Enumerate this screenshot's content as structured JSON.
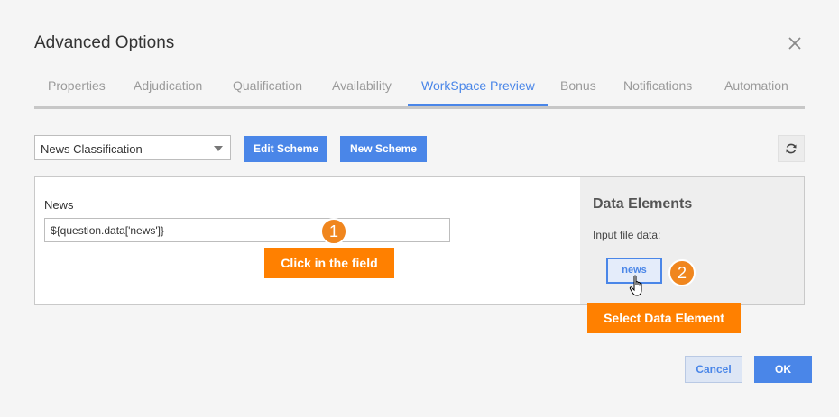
{
  "dialog": {
    "title": "Advanced Options"
  },
  "tabs": [
    {
      "label": "Properties"
    },
    {
      "label": "Adjudication"
    },
    {
      "label": "Qualification"
    },
    {
      "label": "Availability"
    },
    {
      "label": "WorkSpace Preview",
      "active": true
    },
    {
      "label": "Bonus"
    },
    {
      "label": "Notifications"
    },
    {
      "label": "Automation"
    }
  ],
  "toolbar": {
    "scheme_select_value": "News Classification",
    "edit_scheme_label": "Edit Scheme",
    "new_scheme_label": "New Scheme",
    "refresh_icon": "refresh-icon"
  },
  "preview": {
    "field_label": "News",
    "field_value": "${question.data['news']}"
  },
  "data_elements": {
    "title": "Data Elements",
    "subtitle": "Input file data:",
    "items": [
      {
        "label": "news"
      }
    ]
  },
  "annotations": {
    "step1_number": "1",
    "step1_text": "Click in the field",
    "step2_number": "2",
    "step2_text": "Select Data Element"
  },
  "footer": {
    "cancel_label": "Cancel",
    "ok_label": "OK"
  },
  "colors": {
    "accent": "#4a86e8",
    "callout": "#ff8000",
    "badge": "#f0861e"
  }
}
